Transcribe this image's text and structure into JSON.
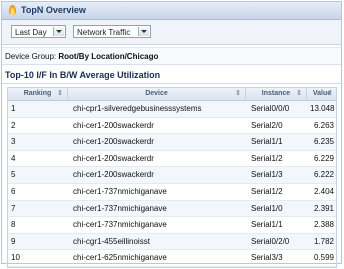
{
  "window": {
    "title": "TopN Overview"
  },
  "toolbar": {
    "time_range": "Last Day",
    "metric": "Network Traffic"
  },
  "group": {
    "label": "Device Group: ",
    "value": "Root/By Location/Chicago"
  },
  "section": {
    "title": "Top-10 I/F In B/W Average Utilization"
  },
  "table": {
    "columns": [
      "Ranking",
      "Device",
      "Instance",
      "Value"
    ],
    "rows": [
      {
        "rank": "1",
        "device": "chi-cpr1-silveredgebusinesssystems",
        "instance": "Serial0/0/0",
        "value": "13.048"
      },
      {
        "rank": "2",
        "device": "chi-cer1-200swackerdr",
        "instance": "Serial2/0",
        "value": "6.263"
      },
      {
        "rank": "3",
        "device": "chi-cer1-200swackerdr",
        "instance": "Serial1/1",
        "value": "6.235"
      },
      {
        "rank": "4",
        "device": "chi-cer1-200swackerdr",
        "instance": "Serial1/2",
        "value": "6.229"
      },
      {
        "rank": "5",
        "device": "chi-cer1-200swackerdr",
        "instance": "Serial1/3",
        "value": "6.222"
      },
      {
        "rank": "6",
        "device": "chi-cer1-737nmichiganave",
        "instance": "Serial1/2",
        "value": "2.404"
      },
      {
        "rank": "7",
        "device": "chi-cer1-737nmichiganave",
        "instance": "Serial1/0",
        "value": "2.391"
      },
      {
        "rank": "8",
        "device": "chi-cer1-737nmichiganave",
        "instance": "Serial1/1",
        "value": "2.388"
      },
      {
        "rank": "9",
        "device": "chi-cgr1-455eillinoisst",
        "instance": "Serial0/2/0",
        "value": "1.782"
      },
      {
        "rank": "10",
        "device": "chi-cer1-625nmichiganave",
        "instance": "Serial3/3",
        "value": "0.599"
      }
    ]
  }
}
